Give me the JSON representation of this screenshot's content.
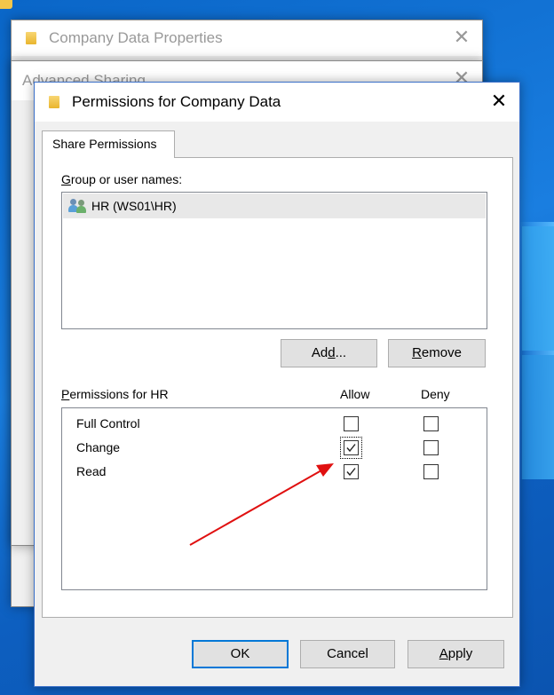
{
  "background_window": {
    "title": "Company Data Properties"
  },
  "middle_window": {
    "title": "Advanced Sharing"
  },
  "dialog": {
    "title": "Permissions for Company Data",
    "tab_label": "Share Permissions",
    "group_label": "Group or user names:",
    "users": [
      {
        "name": "HR (WS01\\HR)",
        "selected": true
      }
    ],
    "add_button": "Add...",
    "remove_button": "Remove",
    "permissions_label": "Permissions for HR",
    "allow_header": "Allow",
    "deny_header": "Deny",
    "permissions": [
      {
        "name": "Full Control",
        "allow": false,
        "deny": false
      },
      {
        "name": "Change",
        "allow": true,
        "deny": false
      },
      {
        "name": "Read",
        "allow": true,
        "deny": false
      }
    ],
    "ok_button": "OK",
    "cancel_button": "Cancel",
    "apply_button": "Apply"
  },
  "colors": {
    "accent": "#0078d7",
    "annotation_arrow": "#e01010",
    "desktop": "#0a66c8"
  }
}
